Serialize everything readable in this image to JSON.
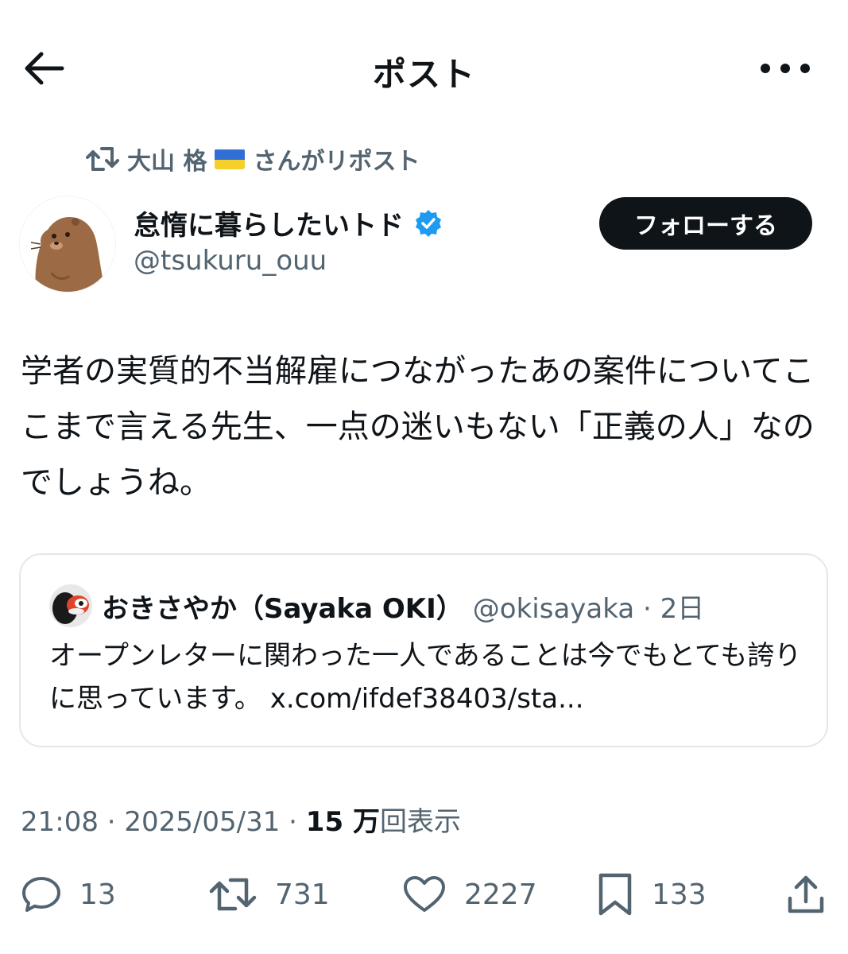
{
  "header": {
    "title": "ポスト",
    "back_icon": "arrow-left-icon",
    "more_icon": "more-horizontal-icon"
  },
  "repost": {
    "icon": "retweet-icon",
    "user": "大山 格",
    "flag": "ukraine-flag-emoji",
    "suffix": "さんがリポスト"
  },
  "author": {
    "name": "怠惰に暮らしたいトド",
    "verified_icon": "verified-badge-icon",
    "handle": "@tsukuru_ouu",
    "follow_label": "フォローする"
  },
  "post": {
    "text": "学者の実質的不当解雇につながったあの案件についてここまで言える先生、一点の迷いもない「正義の人」なのでしょうね。"
  },
  "quote": {
    "name": "おきさやか（Sayaka OKI）",
    "handle_time": "@okisayaka · 2日",
    "text": "オープンレターに関わった一人であることは今でもとても誇りに思っています。 x.com/ifdef38403/sta..."
  },
  "meta": {
    "time": "21:08 · 2025/05/31 · ",
    "views_count": "15 万",
    "views_label": "回表示"
  },
  "actions": {
    "replies": "13",
    "reposts": "731",
    "likes": "2227",
    "bookmarks": "133"
  },
  "colors": {
    "text": "#0f1419",
    "secondary": "#536471",
    "verified": "#1d9bf0",
    "border": "#e1e8ed"
  }
}
